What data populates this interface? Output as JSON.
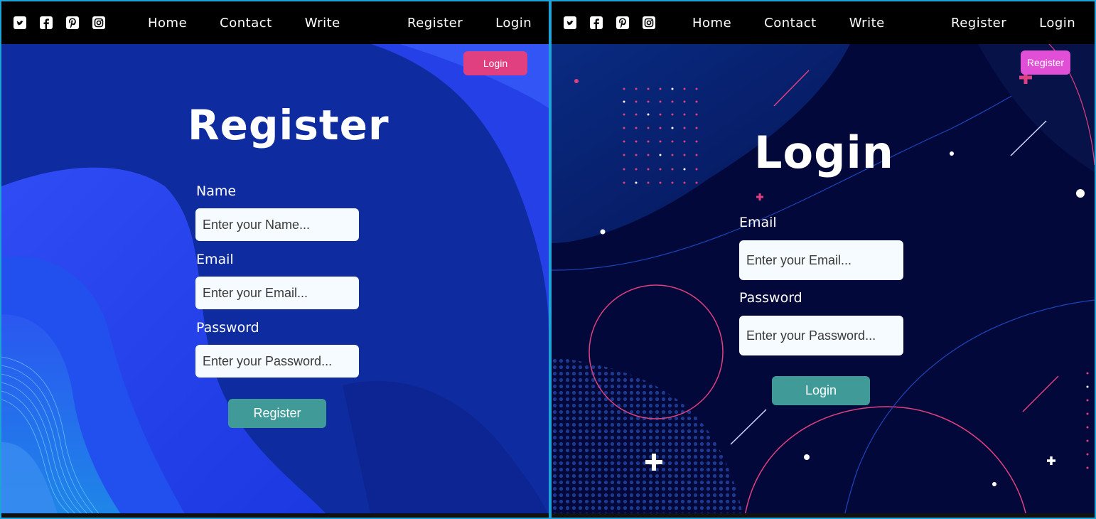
{
  "colors": {
    "accent_teal": "#3f9a98",
    "login_pill": "#e0407f",
    "register_pill": "#e04fd6",
    "register_bg": "#0e2ba0",
    "login_bg": "#03083a",
    "frame": "#1fa2d6"
  },
  "register_page": {
    "navbar": {
      "social_icons": [
        "twitter-icon",
        "facebook-icon",
        "pinterest-icon",
        "instagram-icon"
      ],
      "links": [
        "Home",
        "Contact",
        "Write"
      ],
      "right_links": [
        "Register",
        "Login"
      ]
    },
    "corner_button": "Login",
    "title": "Register",
    "fields": [
      {
        "label": "Name",
        "placeholder": "Enter your Name..."
      },
      {
        "label": "Email",
        "placeholder": "Enter your Email..."
      },
      {
        "label": "Password",
        "placeholder": "Enter your Password..."
      }
    ],
    "submit": "Register"
  },
  "login_page": {
    "navbar": {
      "social_icons": [
        "twitter-icon",
        "facebook-icon",
        "pinterest-icon",
        "instagram-icon"
      ],
      "links": [
        "Home",
        "Contact",
        "Write"
      ],
      "right_links": [
        "Register",
        "Login"
      ]
    },
    "corner_button": "Register",
    "title": "Login",
    "fields": [
      {
        "label": "Email",
        "placeholder": "Enter your Email..."
      },
      {
        "label": "Password",
        "placeholder": "Enter your Password..."
      }
    ],
    "submit": "Login"
  }
}
